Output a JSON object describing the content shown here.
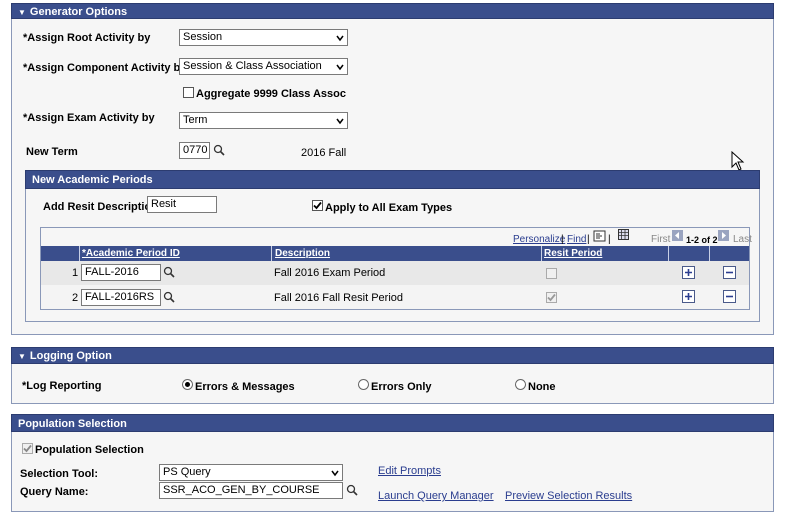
{
  "generator": {
    "header": "Generator Options",
    "assign_root": {
      "label": "*Assign Root Activity by",
      "value": "Session"
    },
    "assign_component": {
      "label": "*Assign Component Activity by",
      "value": "Session & Class Association"
    },
    "aggregate": {
      "label": "Aggregate 9999 Class Assoc",
      "checked": false
    },
    "assign_exam": {
      "label": "*Assign Exam Activity by",
      "value": "Term"
    },
    "new_term": {
      "label": "New Term",
      "value": "0770",
      "description": "2016 Fall"
    }
  },
  "academic_periods": {
    "header": "New Academic Periods",
    "add_resit_label": "Add Resit Description",
    "add_resit_value": "Resit",
    "apply_all_label": "Apply to All Exam Types",
    "apply_all_checked": true,
    "toolbar": {
      "personalize": "Personalize",
      "sep1": "|",
      "find": "Find",
      "sep2": "|",
      "sep3": "|",
      "first": "First",
      "range": "1-2 of 2",
      "last": "Last"
    },
    "columns": [
      "*Academic Period ID",
      "Description",
      "Resit Period"
    ],
    "rows": [
      {
        "num": "1",
        "id": "FALL-2016",
        "description": "Fall 2016 Exam Period",
        "resit": false
      },
      {
        "num": "2",
        "id": "FALL-2016RS",
        "description": "Fall 2016 Fall Resit Period",
        "resit": true
      }
    ]
  },
  "logging": {
    "header": "Logging Option",
    "label": "*Log Reporting",
    "options": [
      "Errors & Messages",
      "Errors Only",
      "None"
    ],
    "selected": "Errors & Messages"
  },
  "population": {
    "header": "Population Selection",
    "checkbox_label": "Population Selection",
    "checkbox_checked": true,
    "tool_label": "Selection Tool:",
    "tool_value": "PS Query",
    "edit_prompts": "Edit Prompts",
    "query_label": "Query Name:",
    "query_value": "SSR_ACO_GEN_BY_COURSE",
    "launch_query": "Launch Query Manager",
    "preview": "Preview Selection Results"
  },
  "colors": {
    "header_bg": "#3a4e8c",
    "link": "#2a3d8f",
    "section_border": "#8a98b8"
  },
  "icons": [
    "triangle-down-icon",
    "lookup-icon",
    "chevron-down-icon",
    "checkmark-icon",
    "view-all-icon",
    "download-icon",
    "first-arrow-icon",
    "last-arrow-icon",
    "plus-icon",
    "minus-icon",
    "mouse-cursor-icon"
  ]
}
